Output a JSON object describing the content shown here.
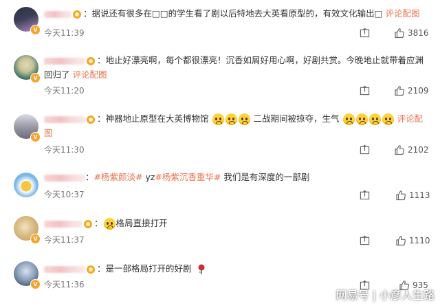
{
  "comments": [
    {
      "text_parts": [
        "据说还有很多在□□的学生看了剧以后特地去大英看原型的，有效文化输出□"
      ],
      "link": "评论配图",
      "time": "今天11:39",
      "likes": "3816",
      "avatar_colors": [
        "#3a3f55",
        "#b08bc4"
      ]
    },
    {
      "text_parts": [
        "地止好漂亮啊，每个都很漂亮！沉香如屑好用心啊，好剧共赏。今晚地止就带着应渊回归了"
      ],
      "link": "评论配图",
      "time": "今天11:20",
      "likes": "2109",
      "avatar_colors": [
        "#2f6e5a",
        "#e3d9b0"
      ]
    },
    {
      "text_parts": [
        "神器地止原型在大英博物馆",
        "二战期间被掠夺，生气"
      ],
      "link": "评论配图",
      "time": "今天11:30",
      "likes": "2102",
      "avatar_colors": [
        "#6b6b7a",
        "#dcdce6"
      ]
    },
    {
      "tags": [
        "#杨紫颜淡#",
        "yz",
        "#杨紫沉香重华#"
      ],
      "text_parts": [
        "我们是有深度的一部剧"
      ],
      "time": "今天10:37",
      "likes": "1113",
      "avatar_colors": [
        "#7bb8e8",
        "#f4c842"
      ]
    },
    {
      "text_parts": [
        "格局直接打开"
      ],
      "time": "今天11:37",
      "likes": "1110",
      "avatar_colors": [
        "#c9a66b",
        "#f1e3c5"
      ]
    },
    {
      "text_parts": [
        "是一部格局打开的好剧"
      ],
      "time": "今天11:36",
      "likes": "935",
      "avatar_colors": [
        "#4a5f7a",
        "#d8e2ee"
      ]
    }
  ],
  "watermark": {
    "left": "网易号",
    "right": "小彦人生路"
  },
  "colors": {
    "link": "#eb7350",
    "time": "#777777",
    "badge": "#f5a623"
  }
}
